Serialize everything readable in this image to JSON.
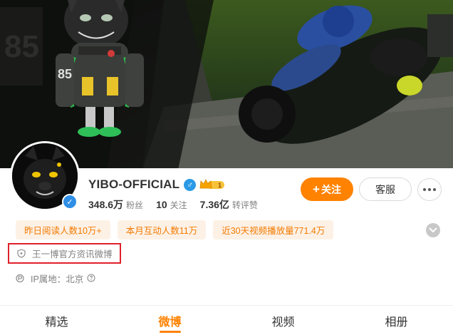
{
  "profile": {
    "name": "YIBO-OFFICIAL",
    "gender_symbol": "♂",
    "verified_mark": "✓",
    "vip_level": "1",
    "description": "王一博官方资讯微博",
    "ip_location": "IP属地：北京",
    "jersey_number": "85"
  },
  "stats": [
    {
      "value": "348.6万",
      "label": "粉丝"
    },
    {
      "value": "10",
      "label": "关注"
    },
    {
      "value": "7.36亿",
      "label": "转评赞"
    }
  ],
  "actions": {
    "follow_plus": "+",
    "follow_label": "关注",
    "service_label": "客服"
  },
  "tags": [
    "昨日阅读人数10万+",
    "本月互动人数11万",
    "近30天视频播放量771.4万"
  ],
  "tabs": [
    {
      "label": "精选",
      "active": false
    },
    {
      "label": "微博",
      "active": true
    },
    {
      "label": "视频",
      "active": false
    },
    {
      "label": "相册",
      "active": false
    }
  ],
  "icons": {
    "more": "more-dots-icon",
    "collapse": "chevron-down-icon",
    "description": "shield-icon",
    "ip": "location-icon",
    "help": "question-circle-icon"
  },
  "colors": {
    "accent": "#ff8200",
    "tag_bg": "#fdf1e6",
    "tag_text": "#f27a00",
    "verified_blue": "#2f8fe6",
    "highlight_border": "#e0202a"
  }
}
